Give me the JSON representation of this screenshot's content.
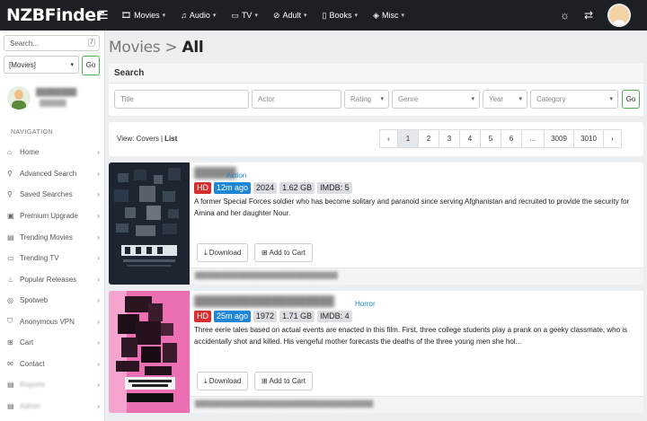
{
  "app": {
    "logo": "NZBFinder",
    "menu_icon": "hamburger-icon"
  },
  "topnav": [
    {
      "icon": "film-icon",
      "label": "Movies"
    },
    {
      "icon": "music-icon",
      "label": "Audio"
    },
    {
      "icon": "tv-icon",
      "label": "TV"
    },
    {
      "icon": "ban-icon",
      "label": "Adult"
    },
    {
      "icon": "book-icon",
      "label": "Books"
    },
    {
      "icon": "gamepad-icon",
      "label": "Misc"
    }
  ],
  "topright": {
    "theme_icon": "lightbulb-icon",
    "swap_icon": "swap-icon",
    "avatar": "user-avatar"
  },
  "sidebar": {
    "search_placeholder": "Search...",
    "search_shortcut": "/",
    "category_value": "[Movies]",
    "go_label": "Go",
    "nav_heading": "NAVIGATION",
    "items": [
      {
        "icon": "home-icon",
        "label": "Home",
        "chevron": "›"
      },
      {
        "icon": "search-icon",
        "label": "Advanced Search",
        "chevron": "›"
      },
      {
        "icon": "search-saved-icon",
        "label": "Saved Searches",
        "chevron": "›"
      },
      {
        "icon": "gift-icon",
        "label": "Premium Upgrade",
        "chevron": "›"
      },
      {
        "icon": "film-icon",
        "label": "Trending Movies",
        "chevron": "›"
      },
      {
        "icon": "tv-icon",
        "label": "Trending TV",
        "chevron": "›"
      },
      {
        "icon": "fire-icon",
        "label": "Popular Releases",
        "chevron": "›"
      },
      {
        "icon": "spotweb-icon",
        "label": "Spotweb",
        "chevron": "›"
      },
      {
        "icon": "shield-icon",
        "label": "Anonymous VPN",
        "chevron": "›"
      },
      {
        "icon": "cart-icon",
        "label": "Cart",
        "chevron": "›"
      },
      {
        "icon": "mail-icon",
        "label": "Contact",
        "chevron": "›"
      },
      {
        "icon": "reports-icon",
        "label": "Reports",
        "chevron": "›"
      },
      {
        "icon": "admin-icon",
        "label": "Admin",
        "chevron": "›"
      }
    ]
  },
  "page": {
    "crumb": "Movies > ",
    "current": "All"
  },
  "search": {
    "header": "Search",
    "title_placeholder": "Title",
    "actor_placeholder": "Actor",
    "rating_label": "Rating",
    "genre_label": "Genre",
    "year_label": "Year",
    "category_label": "Category",
    "go_label": "Go"
  },
  "view": {
    "prefix": "View: ",
    "covers": "Covers",
    "separator": "|",
    "list": "List"
  },
  "pagination": [
    "‹",
    "1",
    "2",
    "3",
    "4",
    "5",
    "6",
    "...",
    "3009",
    "3010",
    "›"
  ],
  "pagination_active": "1",
  "results": [
    {
      "genre": "Action",
      "quality": "HD",
      "age": "12m ago",
      "year": "2024",
      "size": "1.62 GB",
      "imdb": "IMDB: 5",
      "description": "A former Special Forces soldier who has become solitary and paranoid since serving Afghanistan and recruited to provide the security for Amina and her daughter Nour.",
      "download_label": "Download",
      "cart_label": "Add to Cart"
    },
    {
      "genre": "Horror",
      "quality": "HD",
      "age": "25m ago",
      "year": "1972",
      "size": "1.71 GB",
      "imdb": "IMDB: 4",
      "description": "Three eerie tales based on actual events are enacted in this film. First, three college students play a prank on a geeky classmate, who is accidentally shot and killed. His vengeful mother forecasts the deaths of the three young men she hol...",
      "download_label": "Download",
      "cart_label": "Add to Cart"
    }
  ],
  "colors": {
    "topbar": "#1c1f24",
    "hd_badge": "#d42e2e",
    "age_badge": "#1f86d6",
    "genre_link": "#1e88c8",
    "go_border": "#4caf50",
    "poster1_bg": "#1c2530",
    "poster2_bg": "#ec6fb3"
  }
}
